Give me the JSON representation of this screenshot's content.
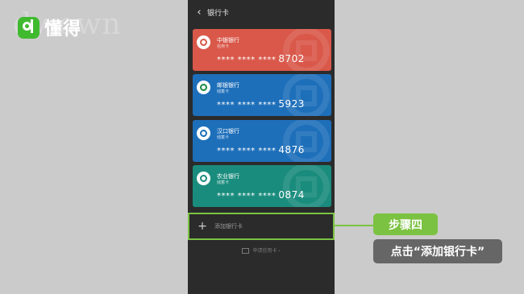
{
  "watermark": {
    "brand": "懂得",
    "ghost_text": "dwown"
  },
  "screen": {
    "title": "银行卡",
    "cards": [
      {
        "bank": "中银银行",
        "type": "信用卡",
        "masked": "**** **** ****",
        "last4": "8702",
        "color": "#d9584a",
        "icon_color": "#d9584a"
      },
      {
        "bank": "邮银银行",
        "type": "储蓄卡",
        "masked": "**** **** ****",
        "last4": "5923",
        "color": "#1e6fba",
        "icon_color": "#1b8a45"
      },
      {
        "bank": "汉口银行",
        "type": "储蓄卡",
        "masked": "**** **** ****",
        "last4": "4876",
        "color": "#1e6fba",
        "icon_color": "#1e6fba"
      },
      {
        "bank": "农业银行",
        "type": "储蓄卡",
        "masked": "**** **** ****",
        "last4": "0874",
        "color": "#1a8c7d",
        "icon_color": "#1a8c7d"
      }
    ],
    "add_card": {
      "label": "添加银行卡"
    },
    "apply_card": {
      "label": "申请信用卡 ›"
    }
  },
  "callout": {
    "step": "步骤四",
    "instruction": "点击“添加银行卡”",
    "accent_color": "#7cc242"
  }
}
